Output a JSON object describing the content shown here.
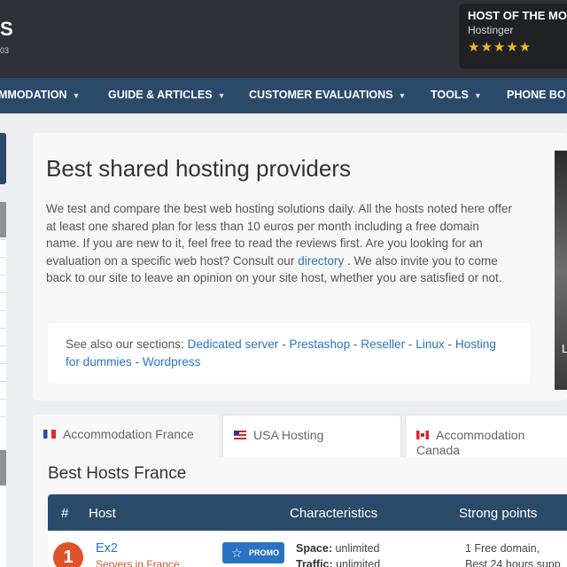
{
  "header": {
    "logo_letter": "S",
    "logo_sub": "03",
    "promo": {
      "title": "HOST OF THE MO",
      "host": "Hostinger",
      "stars": "★★★★★"
    }
  },
  "nav": {
    "items": [
      {
        "label": "MMODATION"
      },
      {
        "label": "GUIDE & ARTICLES"
      },
      {
        "label": "CUSTOMER EVALUATIONS"
      },
      {
        "label": "TOOLS"
      },
      {
        "label": "PHONE BO"
      }
    ]
  },
  "main": {
    "title": "Best shared hosting providers",
    "intro_before": "We test and compare the best web hosting solutions daily. All the hosts noted here offer at least one shared plan for less than 10 euros per month including a free domain name. If you are new to it, feel free to read the reviews first. Are you looking for an evaluation on a specific web host? Consult our ",
    "intro_link": "directory",
    "intro_after": " . We also invite you to come back to our site to leave an opinion on your site host, whether you are satisfied or not.",
    "see_also": {
      "label": "See also our sections: ",
      "links": [
        "Dedicated server",
        "Prestashop",
        "Reseller",
        "Linux",
        "Hosting for dummies",
        "Wordpress"
      ],
      "sep": " - "
    },
    "image_text": "L"
  },
  "tabs": [
    {
      "label": "Accommodation France"
    },
    {
      "label": "USA Hosting"
    },
    {
      "label": "Accommodation Canada"
    }
  ],
  "list": {
    "title": "Best Hosts France",
    "headers": {
      "rank": "#",
      "host": "Host",
      "characteristics": "Characteristics",
      "strong": "Strong points"
    },
    "rows": [
      {
        "rank": "1",
        "name": "Ex2",
        "sub": "Servers in France",
        "promo": "PROMO",
        "spec1_label": "Space:",
        "spec1_value": " unlimited",
        "spec2_label": "Traffic:",
        "spec2_value": " unlimited",
        "strong1": "1 Free domain,",
        "strong2": "Best 24 hours supp"
      }
    ]
  },
  "colors": {
    "header_bg": "#2e3137",
    "nav_bg": "#2b4a6a",
    "link": "#2b73c2",
    "rank_badge": "#e0522a",
    "stars": "#f3b81b"
  }
}
